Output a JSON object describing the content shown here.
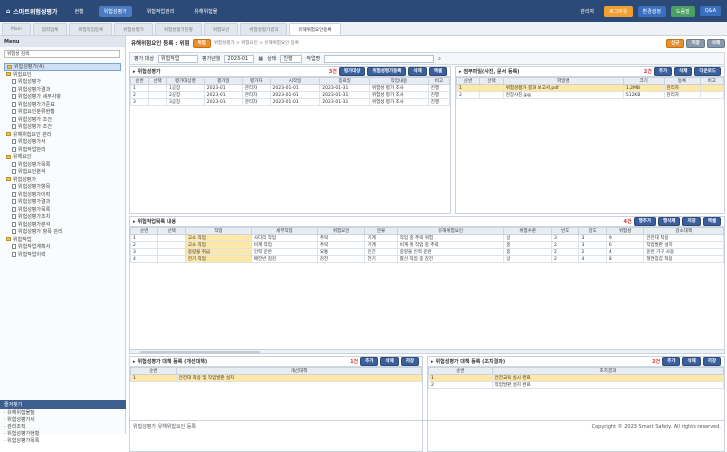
{
  "topbar": {
    "brand": "스마트위험성평가",
    "menus": [
      "현황",
      "위험성평가",
      "위험작업관리",
      "유해위험물"
    ],
    "active_menu": 1,
    "right": [
      "관리자",
      "로그아웃",
      "환경설정",
      "도움말",
      "Q&A"
    ]
  },
  "tabs": [
    "Main",
    "협력업체",
    "위험작업등록",
    "위험성평가",
    "위험성평가현황",
    "위험요인",
    "위험성평가결과",
    "유해위험요인등록"
  ],
  "active_tab": 7,
  "sidebar": {
    "title": "Menu",
    "select": "위험성 검색",
    "tree": [
      {
        "t": "위험성평가(4)",
        "l": 0
      },
      {
        "t": "위험요인",
        "l": 1
      },
      {
        "t": "위험성평가",
        "l": 2
      },
      {
        "t": "위험성평가결과",
        "l": 2
      },
      {
        "t": "위험성평가 세부사항",
        "l": 2
      },
      {
        "t": "위험성평가기준표",
        "l": 2
      },
      {
        "t": "위험요인분류현황",
        "l": 2
      },
      {
        "t": "위험성평가 조건",
        "l": 2
      },
      {
        "t": "위험성평가 조건",
        "l": 2
      },
      {
        "t": "유해위험요인 관리",
        "l": 1
      },
      {
        "t": "위험성평가서",
        "l": 2
      },
      {
        "t": "위험작업관리",
        "l": 2
      },
      {
        "t": "유해요인",
        "l": 1
      },
      {
        "t": "위험성평가목록",
        "l": 2
      },
      {
        "t": "위험요인분석",
        "l": 2
      },
      {
        "t": "위험성평가",
        "l": 1
      },
      {
        "t": "위험성평가항목",
        "l": 2
      },
      {
        "t": "위험성평가이력",
        "l": 2
      },
      {
        "t": "위험성평가결과",
        "l": 2
      },
      {
        "t": "위험성평가목록",
        "l": 2
      },
      {
        "t": "위험성평가조치",
        "l": 2
      },
      {
        "t": "위험성평가분석",
        "l": 2
      },
      {
        "t": "위험성평가 항목 관리",
        "l": 2
      },
      {
        "t": "위험작업",
        "l": 1
      },
      {
        "t": "위험작업계획서",
        "l": 2
      },
      {
        "t": "위험작업이력",
        "l": 2
      }
    ],
    "bottom_title": "즐겨찾기",
    "bottom": [
      "유해위험물질",
      "위험성평가서",
      "관리조직",
      "위험성평가현황",
      "위험성평가목록"
    ]
  },
  "main": {
    "title": "유해위험요인 등록 : 위험",
    "badge": "위험",
    "crumb": "위험성평가 > 위험요인 > 유해위험요인 등록",
    "btns": [
      "신규",
      "저장",
      "삭제"
    ],
    "filter": {
      "label1": "평가 대상",
      "value1": "위험작업",
      "label2": "평가년월",
      "value2": "2023-01",
      "label3": "상태",
      "value3": "진행",
      "label4": "작업명"
    }
  },
  "p1": {
    "title": "위험성평가",
    "count": "3건",
    "tools": [
      "평가대상",
      "위험성평가등록",
      "삭제",
      "엑셀"
    ],
    "cols": [
      "순번",
      "선택",
      "평가대상명",
      "평가일",
      "평가자",
      "시작일",
      "종료일",
      "작업내용",
      "비고"
    ],
    "rows": [
      [
        "1",
        "",
        "1공장",
        "2023-01",
        "관리자",
        "2023-01-01",
        "2023-01-31",
        "위험성 평가 조사",
        "진행"
      ],
      [
        "2",
        "",
        "2공장",
        "2023-01",
        "관리자",
        "2023-01-01",
        "2023-01-31",
        "위험성 평가 조사",
        "진행"
      ],
      [
        "3",
        "",
        "3공장",
        "2023-01",
        "관리자",
        "2023-01-01",
        "2023-01-31",
        "위험성 평가 조사",
        "진행"
      ]
    ]
  },
  "p2": {
    "title": "첨부파일(사진, 문서 등록)",
    "count": "2건",
    "tools": [
      "추가",
      "삭제",
      "다운로드"
    ],
    "cols": [
      "순번",
      "선택",
      "파일명",
      "크기",
      "등록",
      "비고"
    ],
    "rows": [
      [
        "1",
        "",
        "위험성평가 결과 보고서.pdf",
        "1.2MB",
        "관리자",
        ""
      ],
      [
        "2",
        "",
        "현장사진.jpg",
        "512KB",
        "관리자",
        ""
      ]
    ]
  },
  "p3": {
    "title": "위험작업목록 내용",
    "count": "4건",
    "tools": [
      "행추가",
      "행삭제",
      "저장",
      "엑셀"
    ],
    "cols": [
      "순번",
      "선택",
      "작업",
      "세부작업",
      "위험요인",
      "분류",
      "유해위험요인",
      "위험수준",
      "빈도",
      "강도",
      "위험성",
      "감소대책"
    ],
    "rows": [
      [
        "1",
        "",
        "고소 작업",
        "사다리 작업",
        "추락",
        "기계",
        "작업 중 추락 위험",
        "상",
        "3",
        "3",
        "9",
        "안전대 착용"
      ],
      [
        "2",
        "",
        "고소 작업",
        "비계 작업",
        "추락",
        "기계",
        "비계 위 작업 중 추락",
        "중",
        "2",
        "3",
        "6",
        "작업발판 설치"
      ],
      [
        "3",
        "",
        "중량물 취급",
        "인력 운반",
        "요통",
        "인간",
        "중량물 인력 운반",
        "중",
        "2",
        "2",
        "4",
        "운반 기구 사용"
      ],
      [
        "4",
        "",
        "전기 작업",
        "배전반 점검",
        "감전",
        "전기",
        "활선 작업 중 감전",
        "상",
        "2",
        "4",
        "8",
        "절연장갑 착용"
      ]
    ]
  },
  "p4": {
    "title": "위험성평가 대책 등록 (개선대책)",
    "count": "1건",
    "tools": [
      "추가",
      "삭제",
      "저장"
    ],
    "col": "개선대책",
    "rows": [
      "안전대 착용 및 작업발판 설치"
    ]
  },
  "p5": {
    "title": "위험성평가 대책 등록 (조치결과)",
    "count": "2건",
    "tools": [
      "추가",
      "삭제",
      "저장"
    ],
    "col": "조치결과",
    "rows": [
      "안전교육 실시 완료",
      "작업발판 설치 완료"
    ]
  },
  "status": {
    "left": "위험성평가 유해위험요인 등록",
    "right": "Copyright © 2023 Smart Safety. All rights reserved."
  }
}
